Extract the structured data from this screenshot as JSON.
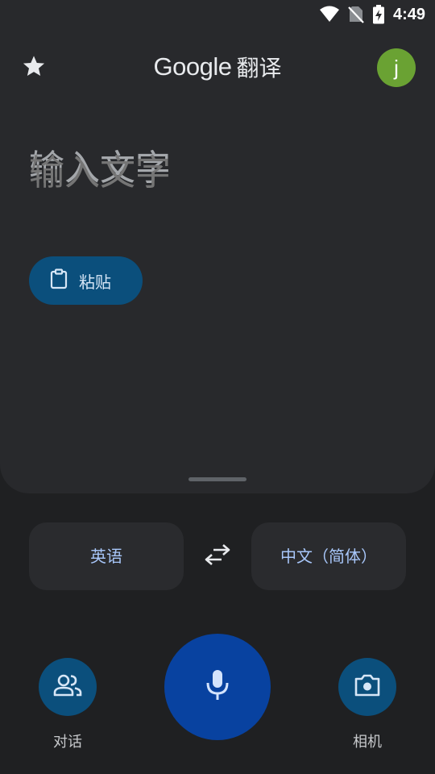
{
  "status_bar": {
    "time": "4:49",
    "icons": [
      "wifi-icon",
      "no-sim-icon",
      "battery-charging-icon"
    ]
  },
  "header": {
    "brand": "Google",
    "product": "翻译",
    "avatar_letter": "j",
    "avatar_color": "#6aa233",
    "star_icon": "star-icon"
  },
  "input": {
    "placeholder": "输入文字",
    "value": ""
  },
  "paste": {
    "label": "粘贴",
    "icon": "clipboard-icon"
  },
  "languages": {
    "source": "英语",
    "target": "中文（简体）",
    "swap_icon": "swap-icon"
  },
  "actions": {
    "conversation_label": "对话",
    "camera_label": "相机",
    "mic_icon": "mic-icon"
  },
  "colors": {
    "accent": "#0842a0",
    "secondary_button": "#0b4f7c",
    "text_accent": "#a8c7fa"
  }
}
